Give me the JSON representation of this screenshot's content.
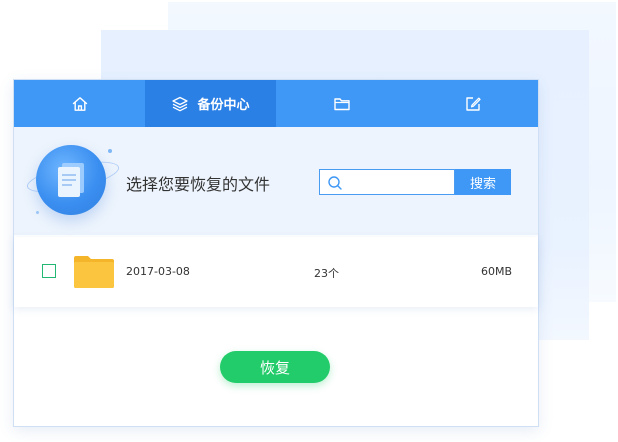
{
  "tabs": [
    {
      "id": "home",
      "icon": "home-icon",
      "label": ""
    },
    {
      "id": "backup",
      "icon": "layers-icon",
      "label": "备份中心",
      "active": true
    },
    {
      "id": "folder",
      "icon": "folder-icon",
      "label": ""
    },
    {
      "id": "edit",
      "icon": "edit-icon",
      "label": ""
    }
  ],
  "hero": {
    "title": "选择您要恢复的文件"
  },
  "search": {
    "placeholder": "",
    "value": "",
    "button_label": "搜索"
  },
  "file_list": [
    {
      "date": "2017-03-08",
      "count": "23个",
      "size": "60MB",
      "checked": false
    }
  ],
  "footer": {
    "restore_label": "恢复"
  },
  "colors": {
    "primary": "#3f98f5",
    "tab_active": "#2b80e6",
    "success": "#23cc6a",
    "folder": "#f9c33d"
  }
}
